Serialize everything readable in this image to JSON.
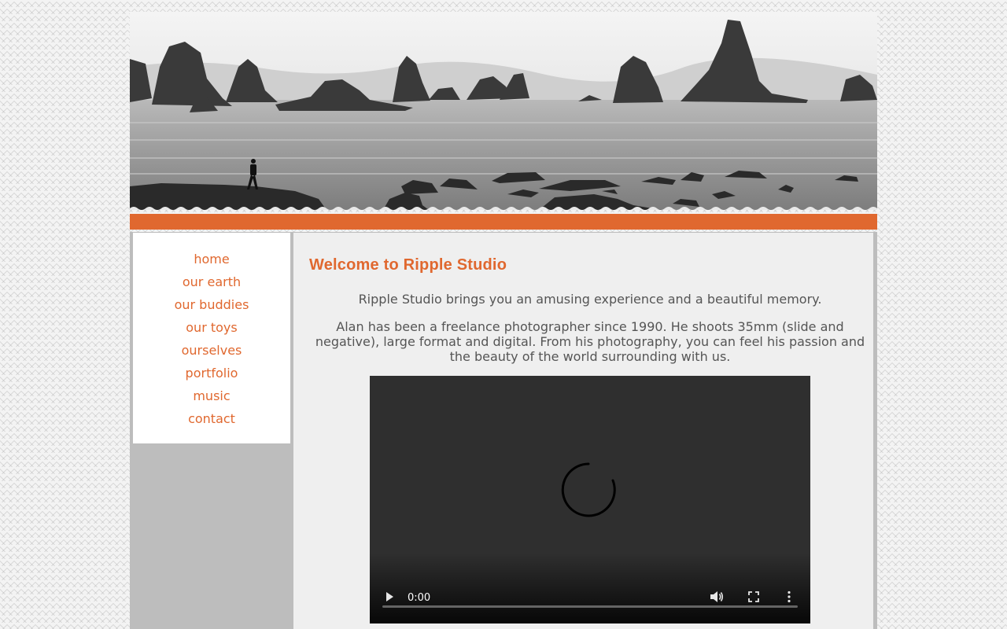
{
  "colors": {
    "accent": "#e0682f",
    "sidebar_bg": "#ffffff",
    "main_bg": "#efefef",
    "frame": "#bdbdbd",
    "text": "#555555",
    "video_bg": "#2f2f2f"
  },
  "nav": {
    "items": [
      {
        "label": "home"
      },
      {
        "label": "our earth"
      },
      {
        "label": "our buddies"
      },
      {
        "label": "our toys"
      },
      {
        "label": "ourselves"
      },
      {
        "label": "portfolio"
      },
      {
        "label": "music"
      },
      {
        "label": "contact"
      }
    ]
  },
  "main": {
    "heading": "Welcome to Ripple Studio",
    "intro": "Ripple Studio brings you an amusing experience and a beautiful memory.",
    "bio": "Alan has been a freelance photographer since 1990. He shoots 35mm (slide and negative), large format and digital. From his photography, you can feel his passion and the beauty of the world surrounding with us."
  },
  "video": {
    "time": "0:00",
    "progress": 0,
    "icons": {
      "play": "play-icon",
      "volume": "volume-icon",
      "fullscreen": "fullscreen-icon",
      "more": "more-options-icon",
      "loading": "loading-spinner-icon"
    }
  }
}
